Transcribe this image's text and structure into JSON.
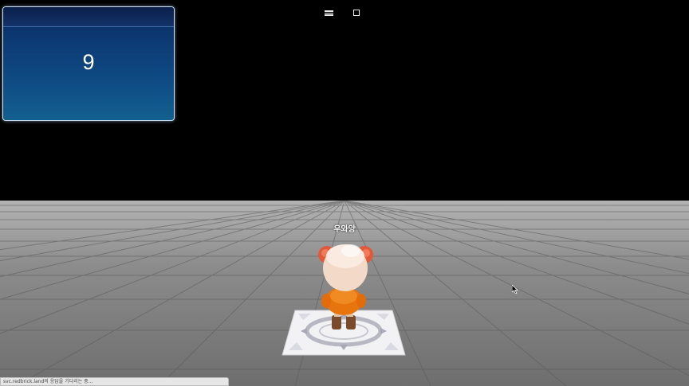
{
  "hud": {
    "counter_value": "9"
  },
  "toolbar": {
    "menu_icon": "hamburger-menu-icon",
    "window_icon": "square-window-icon"
  },
  "player": {
    "name": "우와앙"
  },
  "status_bar": {
    "text": "svc.redbrick.land의 응답을 기다리는 중..."
  },
  "colors": {
    "panel_top": "#0a2a5e",
    "panel_bottom": "#13608f",
    "character_shirt": "#e8740e",
    "character_hair": "#e05a3a",
    "floor": "#8c8c8c"
  }
}
